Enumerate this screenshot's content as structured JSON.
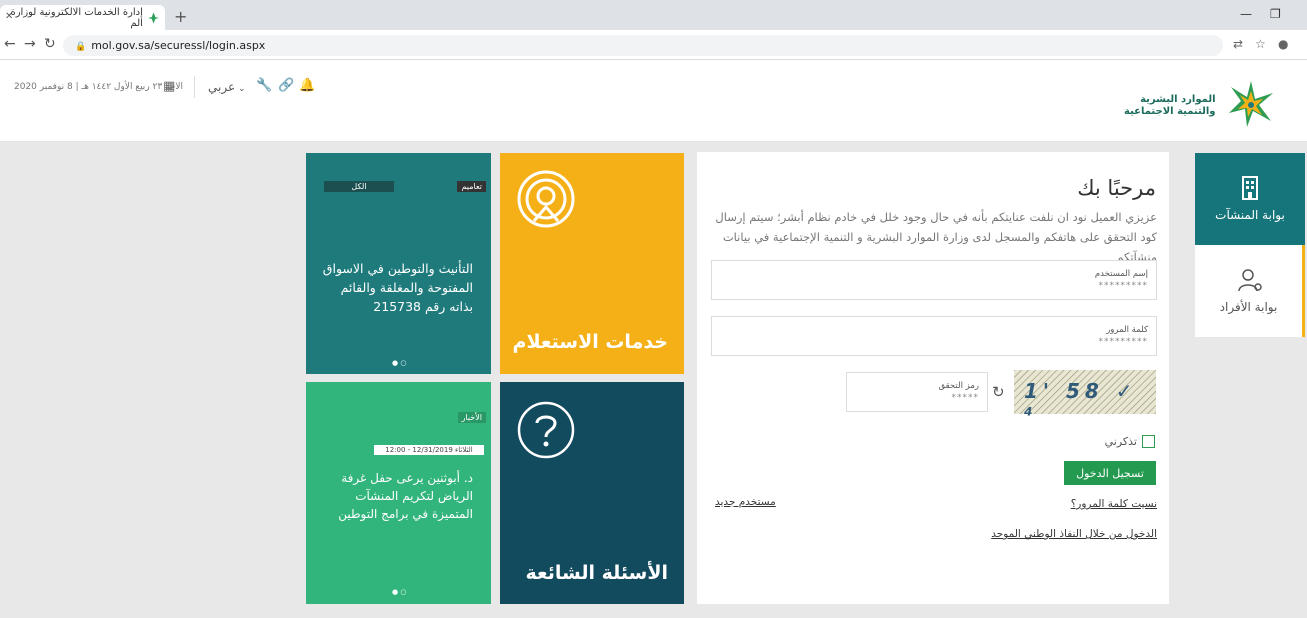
{
  "browser": {
    "tab_title": "إدارة الخدمات الالكترونية لوزارة الم",
    "new_tab": "+",
    "url": "mol.gov.sa/securessl/login.aspx"
  },
  "header": {
    "date_text": "الاحد ٢٣ ربيع الأول ١٤٤٢ هـ | 8 نوفمبر 2020",
    "language": "عربي",
    "logo_line1": "الموارد البشرية",
    "logo_line2": "والتنمية الاجتماعية"
  },
  "tiles": {
    "news1": {
      "badge_type": "تعاميم",
      "badge_all": "الكل",
      "text": "التأنيث والتوطين في الاسواق المفتوحة والمغلقة والقائم بذاته رقم 215738"
    },
    "inquiry": {
      "title": "خدمات الاستعلام"
    },
    "news2": {
      "badge_type": "الأخبار",
      "date": "الثلاثاء 12/31/2019 - 12:00",
      "text": "د. أبوثنين يرعى حفل غرفة الرياض لتكريم المنشآت المتميزة في برامج التوطين"
    },
    "faq": {
      "title": "الأسئلة الشائعة"
    }
  },
  "login": {
    "welcome": "مرحبًا بك",
    "description": "عزيزي العميل نود ان نلفت عنايتكم بأنه في حال وجود خلل في خادم نظام أبشر؛ سيتم إرسال كود التحقق على هاتفكم والمسجل لدى وزارة الموارد البشرية و التنمية الإجتماعية في بيانات منشآتكم",
    "username_label": "إسم المستخدم",
    "username_value": "*********",
    "password_label": "كلمة المرور",
    "password_value": "*********",
    "captcha_label": "رمز التحقق",
    "captcha_value": "*****",
    "captcha_text": "1' 58 ✓ ⁴",
    "remember_label": "تذكرني",
    "login_button": "تسجيل الدخول",
    "forgot_password": "نسيت كلمة المرور؟",
    "new_user": "مستخدم جديد",
    "national_sso": "الدخول من خلال النفاذ الوطني الموحد"
  },
  "side_nav": {
    "establishments": "بوابة المنشآت",
    "individuals": "بوابة الأفراد"
  },
  "colors": {
    "teal": "#1f7a7c",
    "gold": "#f5b018",
    "green": "#32b57d",
    "navy": "#124a5e",
    "button_green": "#239a4f"
  }
}
